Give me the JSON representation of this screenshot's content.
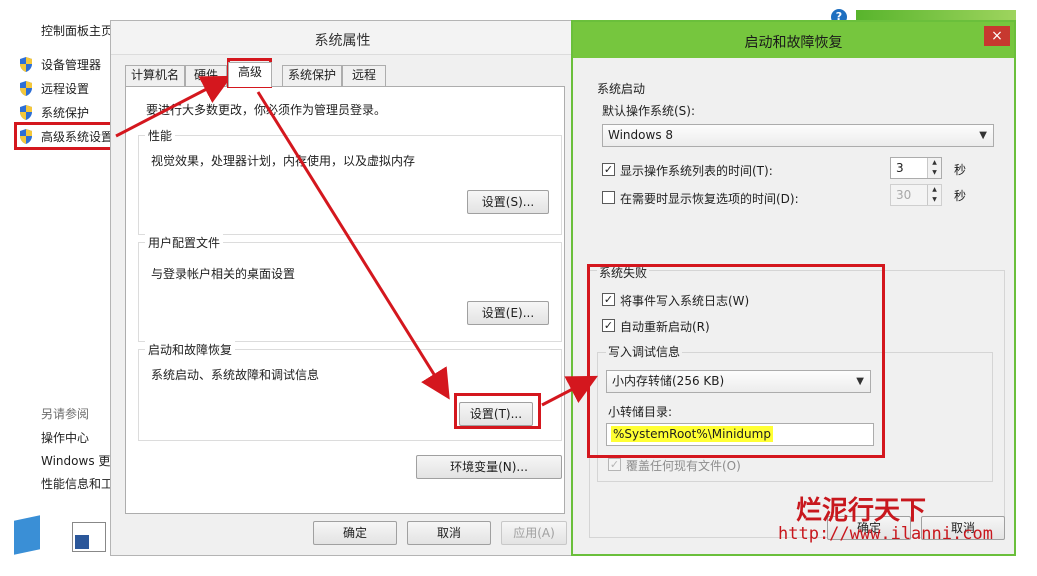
{
  "control_panel": {
    "home": "控制面板主页",
    "items": [
      {
        "label": "设备管理器",
        "icon": "shield-icon"
      },
      {
        "label": "远程设置",
        "icon": "shield-icon"
      },
      {
        "label": "系统保护",
        "icon": "shield-icon"
      },
      {
        "label": "高级系统设置",
        "icon": "shield-icon"
      }
    ],
    "see_also": "另请参阅",
    "links": [
      "操作中心",
      "Windows 更",
      "性能信息和工"
    ]
  },
  "system_properties": {
    "title": "系统属性",
    "tabs": [
      "计算机名",
      "硬件",
      "高级",
      "系统保护",
      "远程"
    ],
    "active_tab": "高级",
    "admin_note": "要进行大多数更改，你必须作为管理员登录。",
    "performance": {
      "label": "性能",
      "desc": "视觉效果，处理器计划，内存使用，以及虚拟内存",
      "button": "设置(S)..."
    },
    "user_profiles": {
      "label": "用户配置文件",
      "desc": "与登录帐户相关的桌面设置",
      "button": "设置(E)..."
    },
    "startup_recovery": {
      "label": "启动和故障恢复",
      "desc": "系统启动、系统故障和调试信息",
      "button": "设置(T)..."
    },
    "env_button": "环境变量(N)...",
    "ok": "确定",
    "cancel": "取消",
    "apply": "应用(A)"
  },
  "startup_recovery": {
    "title": "启动和故障恢复",
    "close": "×",
    "system_startup": {
      "label": "系统启动",
      "default_os_label": "默认操作系统(S):",
      "default_os_value": "Windows 8",
      "show_list_label": "显示操作系统列表的时间(T):",
      "show_list_checked": true,
      "show_list_value": "3",
      "show_recovery_label": "在需要时显示恢复选项的时间(D):",
      "show_recovery_checked": false,
      "show_recovery_value": "30",
      "unit": "秒"
    },
    "system_failure": {
      "label": "系统失败",
      "write_event_label": "将事件写入系统日志(W)",
      "write_event_checked": true,
      "auto_restart_label": "自动重新启动(R)",
      "auto_restart_checked": true,
      "debug_info_label": "写入调试信息",
      "debug_info_value": "小内存转储(256 KB)",
      "dump_dir_label": "小转储目录:",
      "dump_dir_value": "%SystemRoot%\\Minidump",
      "overwrite_label": "覆盖任何现有文件(O)",
      "overwrite_checked": true
    },
    "ok": "确定",
    "cancel": "取消"
  },
  "watermark": {
    "name": "烂泥行天下",
    "url": "http://www.ilanni.com"
  },
  "colors": {
    "highlight": "#d4171e",
    "titlebar_green": "#76c63e",
    "dump_highlight": "#ffff33"
  }
}
